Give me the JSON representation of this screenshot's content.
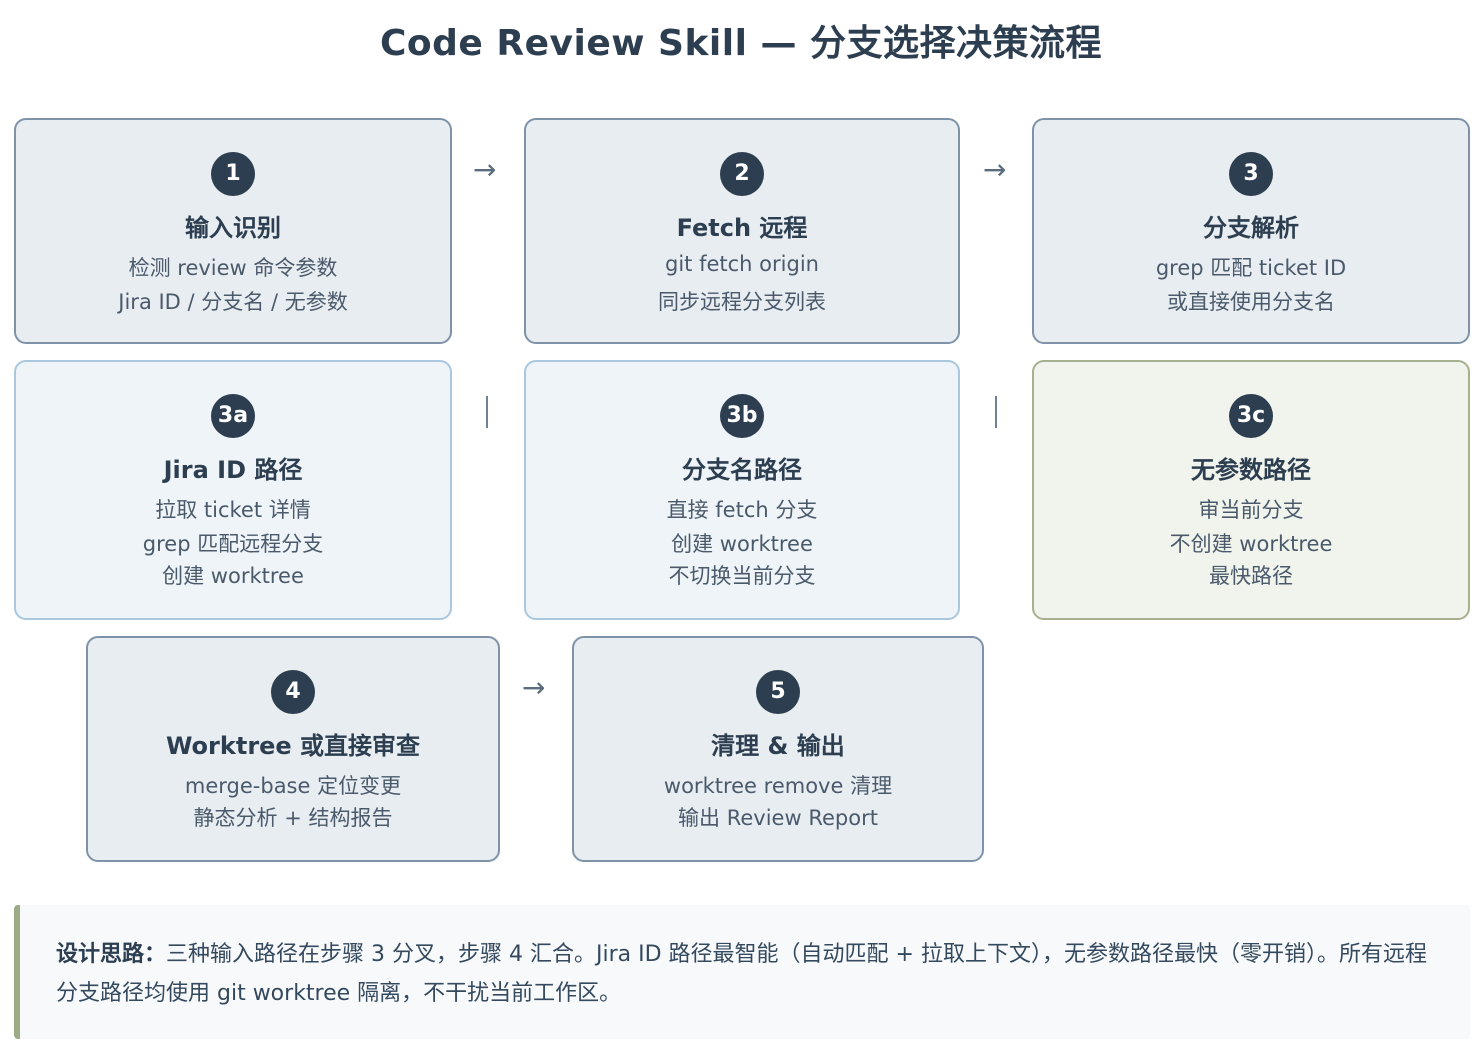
{
  "title": "Code Review Skill — 分支选择决策流程",
  "steps": [
    {
      "num": "1",
      "title": "输入识别",
      "lines": [
        "检测 review 命令参数",
        "Jira ID / 分支名 / 无参数"
      ]
    },
    {
      "num": "2",
      "title": "Fetch 远程",
      "lines": [
        "git fetch origin",
        "同步远程分支列表"
      ]
    },
    {
      "num": "3",
      "title": "分支解析",
      "lines": [
        "grep 匹配 ticket ID",
        "或直接使用分支名"
      ]
    },
    {
      "num": "3a",
      "title": "Jira ID 路径",
      "lines": [
        "拉取 ticket 详情",
        "grep 匹配远程分支",
        "创建 worktree"
      ]
    },
    {
      "num": "3b",
      "title": "分支名路径",
      "lines": [
        "直接 fetch 分支",
        "创建 worktree",
        "不切换当前分支"
      ]
    },
    {
      "num": "3c",
      "title": "无参数路径",
      "lines": [
        "审当前分支",
        "不创建 worktree",
        "最快路径"
      ]
    },
    {
      "num": "4",
      "title": "Worktree 或直接审查",
      "lines": [
        "merge-base 定位变更",
        "静态分析 + 结构报告"
      ]
    },
    {
      "num": "5",
      "title": "清理 & 输出",
      "lines": [
        "worktree remove 清理",
        "输出 Review Report"
      ]
    }
  ],
  "connectors": {
    "arrow": "→"
  },
  "note": {
    "label": "设计思路：",
    "text": "三种输入路径在步骤 3 分叉，步骤 4 汇合。Jira ID 路径最智能（自动匹配 + 拉取上下文），无参数路径最快（零开销）。所有远程分支路径均使用 git worktree 隔离，不干扰当前工作区。"
  },
  "colors": {
    "primary": "#2c3e50",
    "card_bg": "#e8edf2",
    "card_light_bg": "#eef4f8",
    "card_green_bg": "#f1f4ec",
    "note_accent": "#9aab86"
  }
}
